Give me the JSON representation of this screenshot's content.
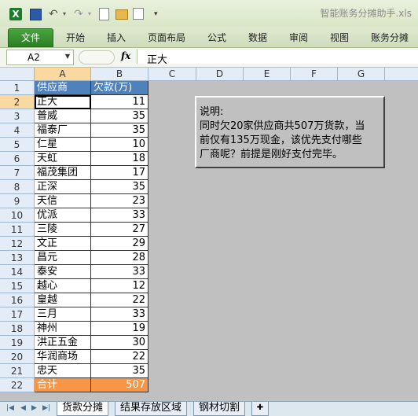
{
  "window": {
    "title": "智能账务分摊助手.xls"
  },
  "quick_access": {
    "excel_icon": "X"
  },
  "ribbon": {
    "tabs": [
      "文件",
      "开始",
      "插入",
      "页面布局",
      "公式",
      "数据",
      "审阅",
      "视图",
      "账务分摊"
    ]
  },
  "formula_bar": {
    "name_box": "A2",
    "fx_label": "fx",
    "content": "正大"
  },
  "grid": {
    "columns": [
      "A",
      "B",
      "C",
      "D",
      "E",
      "F",
      "G"
    ],
    "header": {
      "a": "供应商",
      "b": "欠款(万)"
    },
    "rows": [
      {
        "a": "正大",
        "b": "11"
      },
      {
        "a": "普威",
        "b": "35"
      },
      {
        "a": "福泰厂",
        "b": "35"
      },
      {
        "a": "仁星",
        "b": "10"
      },
      {
        "a": "天虹",
        "b": "18"
      },
      {
        "a": "福茂集团",
        "b": "17"
      },
      {
        "a": "正深",
        "b": "35"
      },
      {
        "a": "天信",
        "b": "23"
      },
      {
        "a": "优派",
        "b": "33"
      },
      {
        "a": "三陵",
        "b": "27"
      },
      {
        "a": "文正",
        "b": "29"
      },
      {
        "a": "昌元",
        "b": "28"
      },
      {
        "a": "泰安",
        "b": "33"
      },
      {
        "a": "越心",
        "b": "12"
      },
      {
        "a": "皇越",
        "b": "22"
      },
      {
        "a": "三月",
        "b": "33"
      },
      {
        "a": "神州",
        "b": "19"
      },
      {
        "a": "洪正五金",
        "b": "30"
      },
      {
        "a": "华润商场",
        "b": "22"
      },
      {
        "a": "忠天",
        "b": "35"
      }
    ],
    "total": {
      "a": "合计",
      "b": "507"
    },
    "row_numbers": [
      "1",
      "2",
      "3",
      "4",
      "5",
      "6",
      "7",
      "8",
      "9",
      "10",
      "11",
      "12",
      "13",
      "14",
      "15",
      "16",
      "17",
      "18",
      "19",
      "20",
      "21",
      "22"
    ]
  },
  "note": {
    "lines": [
      "说明:",
      "同时欠20家供应商共507万货款，当",
      "前仅有135万现金，该优先支付哪些",
      "厂商呢？前提是刚好支付完毕。"
    ]
  },
  "sheet_tabs": [
    "货款分摊",
    "结果存放区域",
    "钢材切割"
  ],
  "colors": {
    "header_fill": "#4f81bd",
    "total_fill": "#f79646",
    "file_tab": "#2c7f24",
    "background": "#c0c0c0"
  }
}
